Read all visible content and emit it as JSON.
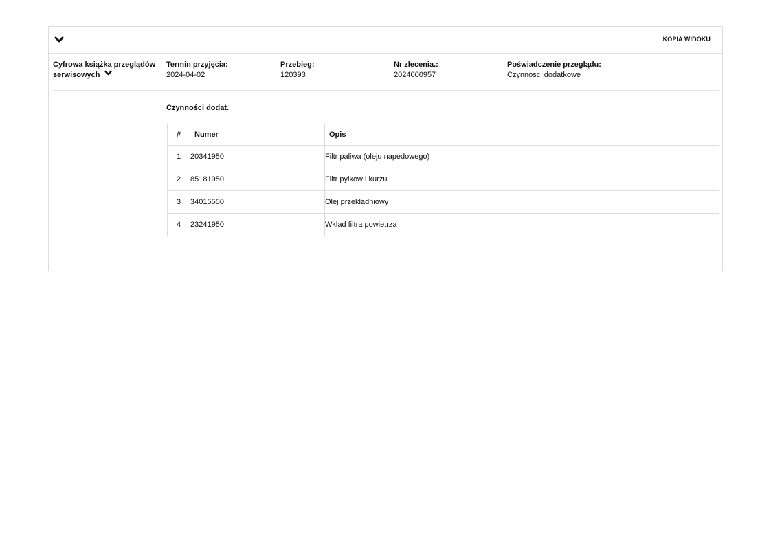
{
  "header": {
    "copy_view_label": "KOPIA WIDOKU",
    "collapse_icon": "chevron-down-icon"
  },
  "book": {
    "title": "Cyfrowa książka przeglądów serwisowych",
    "expand_icon": "chevron-down-icon"
  },
  "fields": [
    {
      "label": "Termin przyjęcia:",
      "value": "2024-04-02"
    },
    {
      "label": "Przebieg:",
      "value": "120393"
    },
    {
      "label": "Nr zlecenia.:",
      "value": "2024000957"
    },
    {
      "label": "Poświadczenie przeglądu:",
      "value": "Czynnosci dodatkowe"
    }
  ],
  "section": {
    "title": "Czynności dodat.",
    "columns": [
      "#",
      "Numer",
      "Opis"
    ],
    "rows": [
      {
        "idx": "1",
        "number": "20341950",
        "desc": "Filtr paliwa (oleju napedowego)"
      },
      {
        "idx": "2",
        "number": "85181950",
        "desc": "Filtr pylkow i kurzu"
      },
      {
        "idx": "3",
        "number": "34015550",
        "desc": "Olej przekladniowy"
      },
      {
        "idx": "4",
        "number": "23241950",
        "desc": "Wklad filtra powietrza"
      }
    ]
  }
}
